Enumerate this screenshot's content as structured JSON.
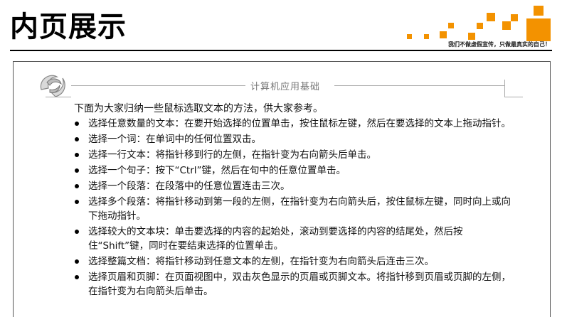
{
  "page": {
    "title": "内页展示",
    "slogan": "我们不做虚假宣传，只做最真实的自己！",
    "accent_color": "#f39200"
  },
  "book": {
    "running_head": "计算机应用基础",
    "intro": "下面为大家归纳一些鼠标选取文本的方法，供大家参考。",
    "items": [
      "选择任意数量的文本：在要开始选择的位置单击，按住鼠标左键，然后在要选择的文本上拖动指针。",
      "选择一个词：在单词中的任何位置双击。",
      "选择一行文本：将指针移到行的左侧，在指针变为右向箭头后单击。",
      "选择一个句子：按下“Ctrl”键，然后在句中的任意位置单击。",
      "选择一个段落：在段落中的任意位置连击三次。",
      "选择多个段落：将指针移动到第一段的左侧，在指针变为右向箭头后，按住鼠标左键，同时向上或向下拖动指针。",
      "选择较大的文本块：单击要选择的内容的起始处，滚动到要选择的内容的结尾处，然后按住“Shift”键，同时在要结束选择的位置单击。",
      "选择整篇文档：将指针移动到任意文本的左侧，在指针变为右向箭头后连击三次。",
      "选择页眉和页脚：在页面视图中，双击灰色显示的页眉或页脚文本。将指针移到页眉或页脚的左侧，在指针变为右向箭头后单击。"
    ]
  }
}
